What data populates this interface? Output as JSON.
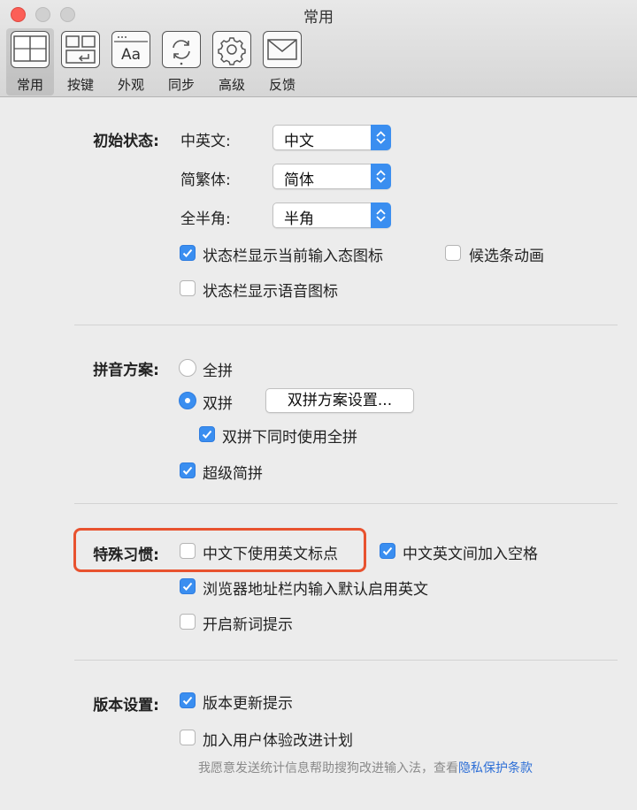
{
  "window": {
    "title": "常用"
  },
  "toolbar": {
    "items": [
      {
        "label": "常用",
        "icon": "general-icon"
      },
      {
        "label": "按键",
        "icon": "keys-icon"
      },
      {
        "label": "外观",
        "icon": "appearance-icon",
        "icon_text": "Aa"
      },
      {
        "label": "同步",
        "icon": "sync-icon"
      },
      {
        "label": "高级",
        "icon": "gear-icon"
      },
      {
        "label": "反馈",
        "icon": "envelope-icon"
      }
    ]
  },
  "initial_state": {
    "label": "初始状态:",
    "lang": {
      "label": "中英文:",
      "value": "中文"
    },
    "charset": {
      "label": "简繁体:",
      "value": "简体"
    },
    "width": {
      "label": "全半角:",
      "value": "半角"
    },
    "show_status_icon": {
      "label": "状态栏显示当前输入态图标",
      "checked": true
    },
    "candidate_animation": {
      "label": "候选条动画",
      "checked": false
    },
    "show_voice_icon": {
      "label": "状态栏显示语音图标",
      "checked": false
    }
  },
  "pinyin": {
    "label": "拼音方案:",
    "full": {
      "label": "全拼",
      "selected": false
    },
    "double": {
      "label": "双拼",
      "selected": true
    },
    "double_settings_button": "双拼方案设置...",
    "double_also_full": {
      "label": "双拼下同时使用全拼",
      "checked": true
    },
    "super_abbrev": {
      "label": "超级简拼",
      "checked": true
    }
  },
  "habits": {
    "label": "特殊习惯:",
    "english_punct": {
      "label": "中文下使用英文标点",
      "checked": false
    },
    "add_space": {
      "label": "中文英文间加入空格",
      "checked": true
    },
    "browser_english": {
      "label": "浏览器地址栏内输入默认启用英文",
      "checked": true
    },
    "new_word_tip": {
      "label": "开启新词提示",
      "checked": false
    }
  },
  "version": {
    "label": "版本设置:",
    "update_tip": {
      "label": "版本更新提示",
      "checked": true
    },
    "ux_plan": {
      "label": "加入用户体验改进计划",
      "checked": false
    },
    "footnote": "我愿意发送统计信息帮助搜狗改进输入法，查看",
    "privacy_link": "隐私保护条款"
  },
  "colors": {
    "accent": "#3a8ef0",
    "highlight": "#e8522f",
    "close": "#fc5f57"
  }
}
